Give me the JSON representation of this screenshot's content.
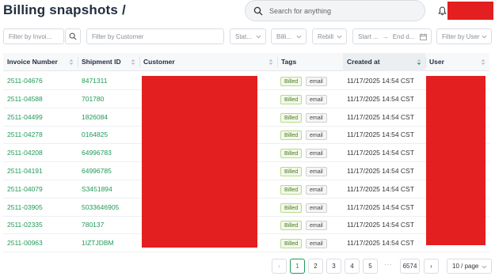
{
  "header": {
    "title": "Billing snapshots /",
    "search_placeholder": "Search for anything"
  },
  "filters": {
    "invoice": "Filter by Invoi...",
    "customer": "Filter by Customer",
    "status": "Stat...",
    "billing": "Billi...",
    "rebill": "Rebill",
    "start_date": "Start ...",
    "end_date": "End d...",
    "user": "Filter by User"
  },
  "columns": [
    "Invoice Number",
    "Shipment ID",
    "Customer",
    "Tags",
    "Created at",
    "User"
  ],
  "rows": [
    {
      "invoice": "2511-04676",
      "shipment": "8471311",
      "tags": [
        "Billed",
        "email"
      ],
      "created": "11/17/2025 14:54 CST"
    },
    {
      "invoice": "2511-04588",
      "shipment": "701780",
      "tags": [
        "Billed",
        "email"
      ],
      "created": "11/17/2025 14:54 CST"
    },
    {
      "invoice": "2511-04499",
      "shipment": "1826084",
      "tags": [
        "Billed",
        "email"
      ],
      "created": "11/17/2025 14:54 CST"
    },
    {
      "invoice": "2511-04278",
      "shipment": "0164825",
      "tags": [
        "Billed",
        "email"
      ],
      "created": "11/17/2025 14:54 CST"
    },
    {
      "invoice": "2511-04208",
      "shipment": "64996783",
      "tags": [
        "Billed",
        "email"
      ],
      "created": "11/17/2025 14:54 CST"
    },
    {
      "invoice": "2511-04191",
      "shipment": "64996785",
      "tags": [
        "Billed",
        "email"
      ],
      "created": "11/17/2025 14:54 CST"
    },
    {
      "invoice": "2511-04079",
      "shipment": "S3451894",
      "tags": [
        "Billed",
        "email"
      ],
      "created": "11/17/2025 14:54 CST"
    },
    {
      "invoice": "2511-03905",
      "shipment": "5033646905",
      "tags": [
        "Billed",
        "email"
      ],
      "created": "11/17/2025 14:54 CST"
    },
    {
      "invoice": "2511-02335",
      "shipment": "780137",
      "tags": [
        "Billed",
        "email"
      ],
      "created": "11/17/2025 14:54 CST"
    },
    {
      "invoice": "2511-00963",
      "shipment": "1IZTJDBM",
      "tags": [
        "Billed",
        "email"
      ],
      "created": "11/17/2025 14:54 CST"
    }
  ],
  "pagination": {
    "pages": [
      "1",
      "2",
      "3",
      "4",
      "5"
    ],
    "ellipsis": "···",
    "last": "6574",
    "current": "1",
    "page_size": "10 / page"
  },
  "colors": {
    "link": "#1f9a57",
    "redaction": "#e41f1f"
  }
}
